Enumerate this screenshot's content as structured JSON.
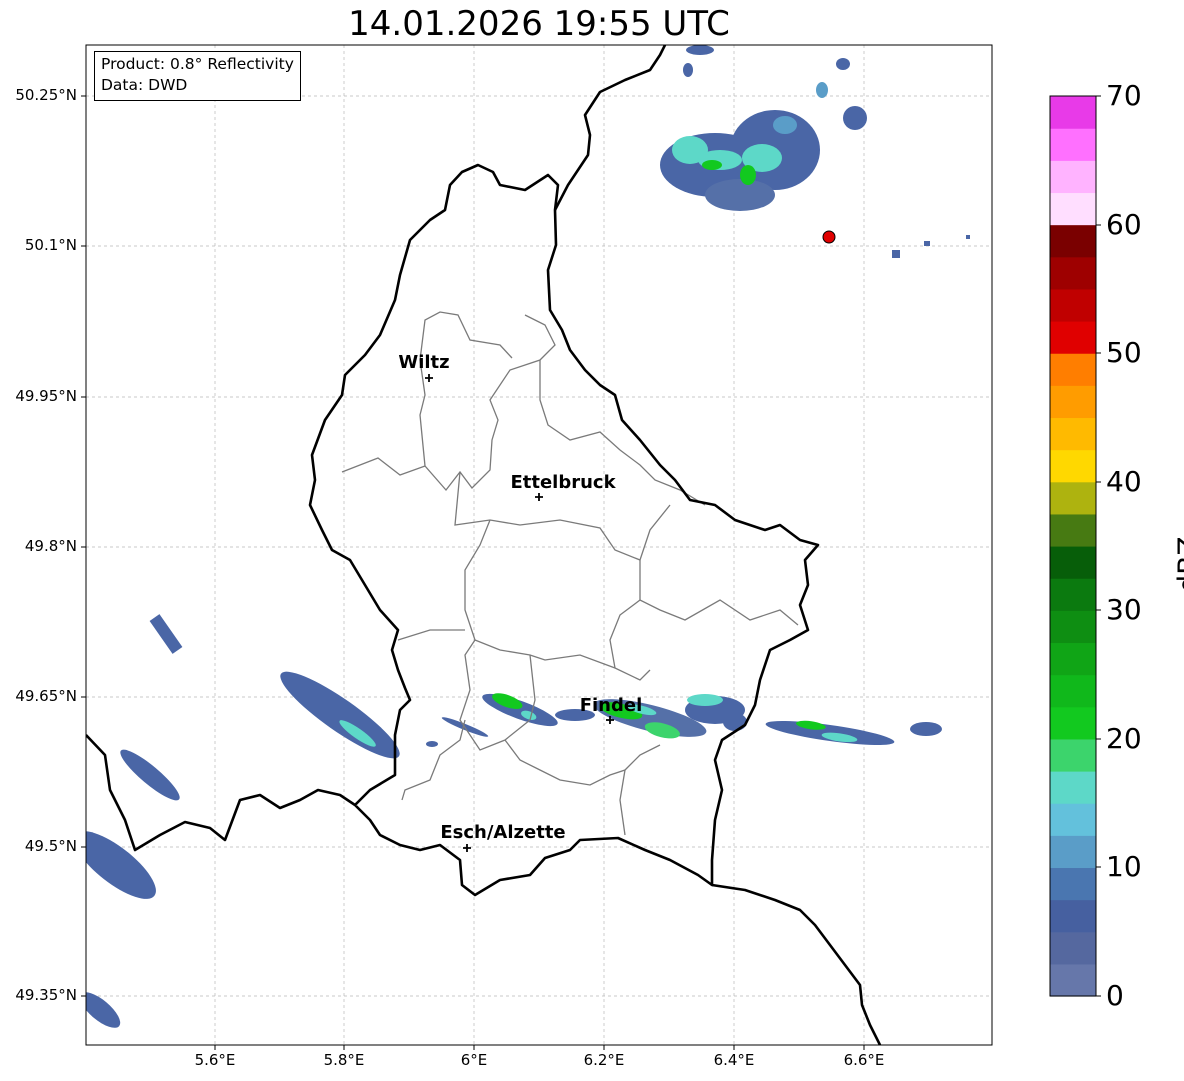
{
  "title": "14.01.2026 19:55 UTC",
  "info": {
    "product": "Product: 0.8° Reflectivity",
    "data_source": "Data: DWD"
  },
  "axes": {
    "lat_labels": [
      "50.25°N",
      "50.1°N",
      "49.95°N",
      "49.8°N",
      "49.65°N",
      "49.5°N",
      "49.35°N"
    ],
    "lon_labels": [
      "5.6°E",
      "5.8°E",
      "6°E",
      "6.2°E",
      "6.4°E",
      "6.6°E"
    ]
  },
  "cities": [
    {
      "name": "Wiltz"
    },
    {
      "name": "Ettelbruck"
    },
    {
      "name": "Findel"
    },
    {
      "name": "Esch/Alzette"
    }
  ],
  "colorbar": {
    "label": "dBZ",
    "ticks": [
      "70",
      "60",
      "50",
      "40",
      "30",
      "20",
      "10",
      "0"
    ],
    "colors": [
      "#6677aa",
      "#55689f",
      "#4660a0",
      "#4a76b0",
      "#5a9dc8",
      "#63c1dc",
      "#5dd8c8",
      "#3cd46c",
      "#12c91f",
      "#10b81b",
      "#10a516",
      "#0e8e12",
      "#0b7a0f",
      "#075e09",
      "#477a12",
      "#aeb30f",
      "#ffd800",
      "#ffba00",
      "#ff9c00",
      "#ff7e00",
      "#e00000",
      "#c00000",
      "#9e0000",
      "#7a0000",
      "#ffdeff",
      "#ffb3ff",
      "#ff70ff",
      "#e83ae8"
    ]
  },
  "station_color": "#e00000"
}
